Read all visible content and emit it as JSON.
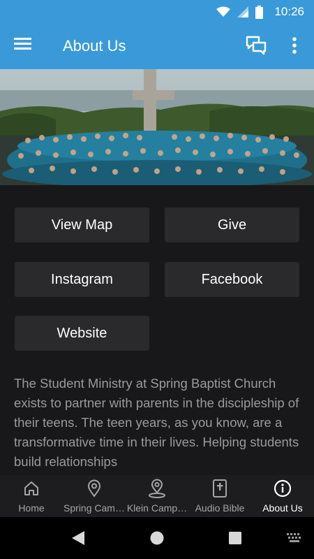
{
  "status": {
    "time": "10:26"
  },
  "header": {
    "title": "About Us"
  },
  "hero": {
    "alt": "Group photo of students in front of a cross by a lake"
  },
  "buttons": {
    "view_map": "View Map",
    "give": "Give",
    "instagram": "Instagram",
    "facebook": "Facebook",
    "website": "Website"
  },
  "description": "The Student Ministry at Spring Baptist Church exists to partner with parents in the discipleship of their teens. The teen years, as you know, are a transformative time in their lives. Helping students build relationships",
  "tabs": [
    {
      "label": "Home",
      "icon": "home-icon"
    },
    {
      "label": "Spring Cam…",
      "icon": "map-pin-icon"
    },
    {
      "label": "Klein Camp…",
      "icon": "location-icon"
    },
    {
      "label": "Audio Bible",
      "icon": "bible-icon"
    },
    {
      "label": "About Us",
      "icon": "info-icon"
    }
  ],
  "active_tab": "About Us",
  "colors": {
    "primary": "#3a9ad9",
    "background": "#18181a",
    "button": "#2a2a2c"
  }
}
